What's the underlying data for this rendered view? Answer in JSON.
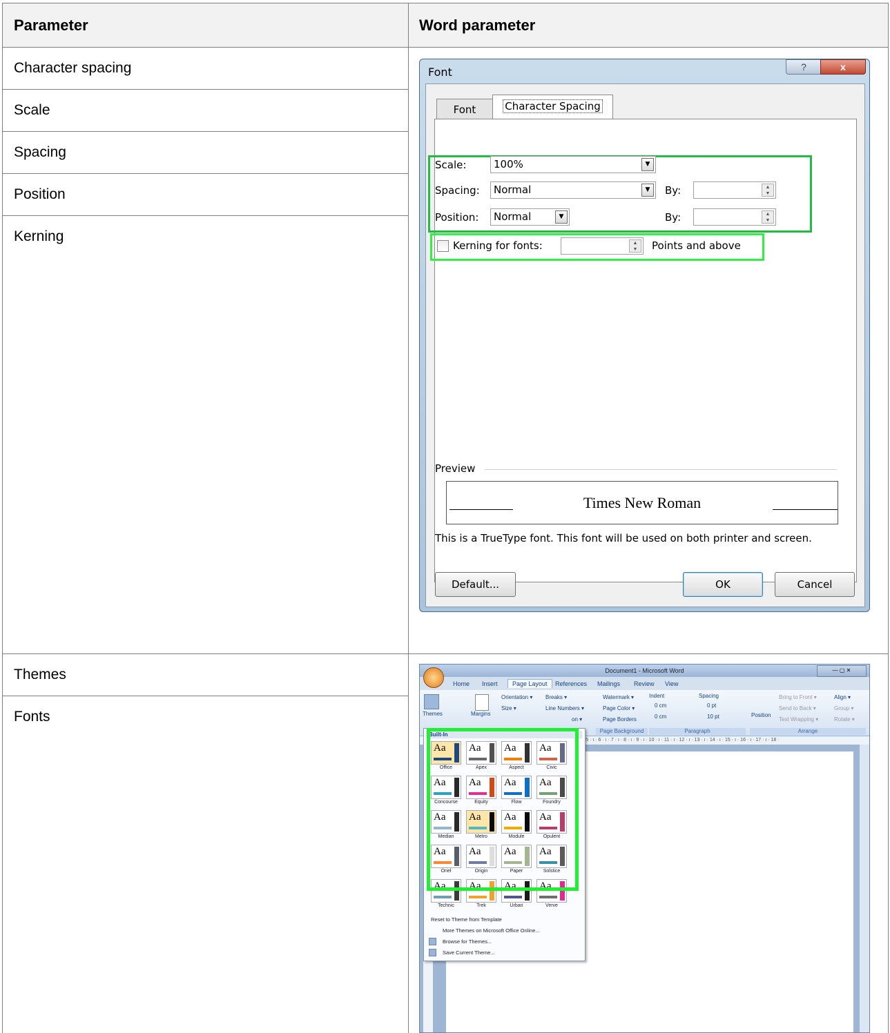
{
  "table": {
    "header": {
      "col1": "Parameter",
      "col2": "Word parameter"
    },
    "row1_params": [
      "Character spacing",
      "Scale",
      "Spacing",
      "Position",
      "Kerning"
    ],
    "row2_params": [
      "Themes",
      "Fonts"
    ]
  },
  "font_dialog": {
    "title": "Font",
    "help_btn": "?",
    "close_btn": "x",
    "tabs": [
      "Font",
      "Character Spacing"
    ],
    "scale_label": "Scale:",
    "scale_value": "100%",
    "spacing_label": "Spacing:",
    "spacing_value": "Normal",
    "position_label": "Position:",
    "position_value": "Normal",
    "by_label": "By:",
    "kerning_label": "Kerning for fonts:",
    "kerning_checked": false,
    "points_label": "Points and above",
    "preview_label": "Preview",
    "preview_text": "Times New Roman",
    "note": "This is a TrueType font. This font will be used on both printer and screen.",
    "default_btn": "Default...",
    "ok_btn": "OK",
    "cancel_btn": "Cancel",
    "highlight_color": "#22bb44"
  },
  "word": {
    "title": "Document1 - Microsoft Word",
    "ribbon_tabs": [
      "Home",
      "Insert",
      "Page Layout",
      "References",
      "Mailings",
      "Review",
      "View"
    ],
    "active_tab": "Page Layout",
    "ribbon": {
      "themes": "Themes",
      "margins": "Margins",
      "orientation": "Orientation ▾",
      "size": "Size ▾",
      "breaks": "Breaks ▾",
      "line_numbers": "Line Numbers ▾",
      "hyphenation": "on ▾",
      "watermark": "Watermark ▾",
      "page_color": "Page Color ▾",
      "page_borders": "Page Borders",
      "indent": "Indent",
      "indent_left": "0 cm",
      "indent_right": "0 cm",
      "spacing": "Spacing",
      "spacing_before": "0 pt",
      "spacing_after": "10 pt",
      "position": "Position",
      "bring_to_front": "Bring to Front ▾",
      "send_to_back": "Send to Back ▾",
      "text_wrapping": "Text Wrapping ▾",
      "align": "Align ▾",
      "group": "Group ▾",
      "rotate": "Rotate ▾",
      "grp_page_background": "Page Background",
      "grp_paragraph": "Paragraph",
      "grp_arrange": "Arrange"
    },
    "ruler_text": "· 5 · ı · 6 · ı · 7 · ı · 8 · ı · 9 · ı · 10 · ı · 11 · ı · 12 · ı · 13 · ı · 14 · ı · 15 · ı · 16 · ı · 17 · ı · 18 ·",
    "gallery_header": "Built-In",
    "themes": [
      "Office",
      "Apex",
      "Aspect",
      "Civic",
      "Concourse",
      "Equity",
      "Flow",
      "Foundry",
      "Median",
      "Metro",
      "Module",
      "Opulent",
      "Oriel",
      "Origin",
      "Paper",
      "Solstice",
      "Technic",
      "Trek",
      "Urban",
      "Verve"
    ],
    "theme_accents": [
      "#1f497d",
      "#69676d",
      "#f07f09",
      "#d16349",
      "#2da2bf",
      "#e32d91",
      "#0f6fc6",
      "#72a376",
      "#94b6d2",
      "#4fb8c1",
      "#f0ad00",
      "#b83d68",
      "#fe8637",
      "#727ca3",
      "#a5b592",
      "#3891a7",
      "#6ea0b0",
      "#f0a22e",
      "#53548a",
      "#6e6e6e"
    ],
    "theme_sides": [
      "#1f497d",
      "#505050",
      "#323232",
      "#646b86",
      "#2a2a2a",
      "#d34817",
      "#0f6fc6",
      "#4a4a4a",
      "#2a2a2a",
      "#0a0a0a",
      "#0a0a0a",
      "#b83d68",
      "#575f6d",
      "#dddddd",
      "#a5b592",
      "#5a5a5a",
      "#3b3b3b",
      "#f0a22e",
      "#1d1a1d",
      "#e22891"
    ],
    "gallery_items": [
      "Reset to Theme from Template",
      "More Themes on Microsoft Office Online...",
      "Browse for Themes...",
      "Save Current Theme..."
    ]
  }
}
